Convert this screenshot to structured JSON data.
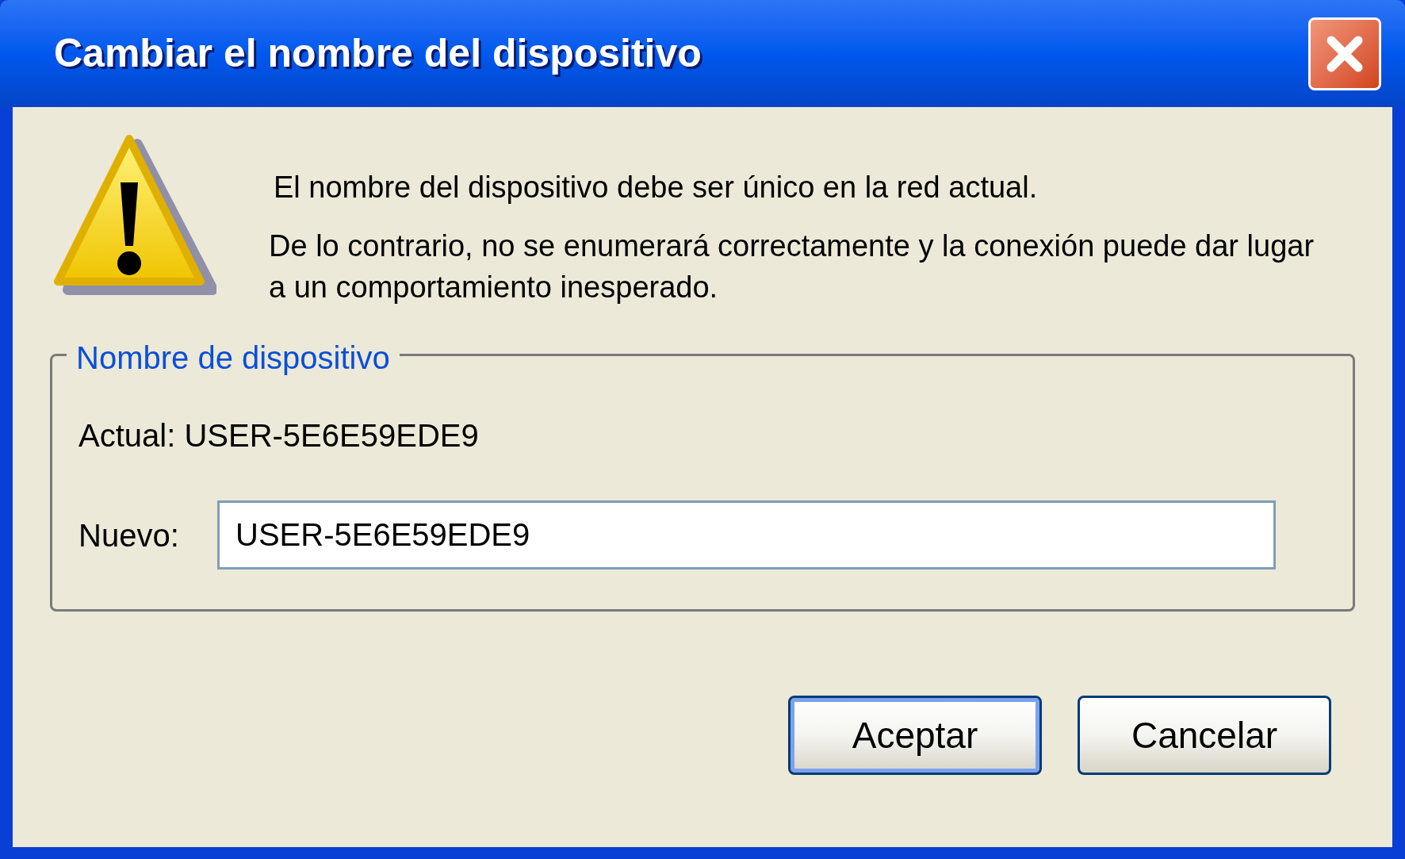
{
  "window": {
    "title": "Cambiar el nombre del dispositivo"
  },
  "message": [
    "El nombre del dispositivo debe ser único en la red actual.",
    "De lo contrario, no se enumerará correctamente y la conexión puede dar lugar a un comportamiento inesperado."
  ],
  "group": {
    "legend": "Nombre de dispositivo",
    "current": "Actual: USER-5E6E59EDE9",
    "new_label": "Nuevo:",
    "new_value": "USER-5E6E59EDE9"
  },
  "buttons": [
    {
      "label": "Aceptar",
      "default": true
    },
    {
      "label": "Cancelar",
      "default": false
    }
  ]
}
